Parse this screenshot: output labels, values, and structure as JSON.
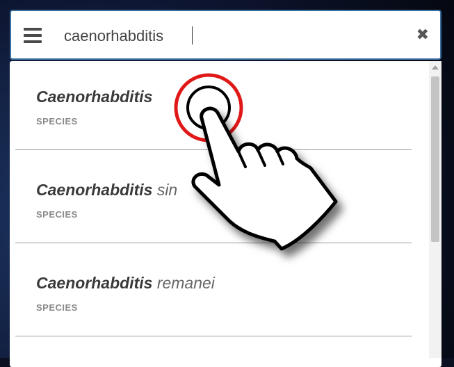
{
  "search": {
    "value": "caenorhabditis",
    "menu_icon": "hamburger-menu-icon",
    "clear_icon": "close-icon",
    "clear_glyph": "✖"
  },
  "results": [
    {
      "genus": "Caenorhabditis",
      "species": "",
      "type": "SPECIES"
    },
    {
      "genus": "Caenorhabditis",
      "species": "sin",
      "type": "SPECIES"
    },
    {
      "genus": "Caenorhabditis",
      "species": "remanei",
      "type": "SPECIES"
    }
  ],
  "overlay": {
    "icon": "tap-hand-icon"
  },
  "colors": {
    "search_border": "#3c6f9e",
    "tap_ring": "#e01818"
  }
}
